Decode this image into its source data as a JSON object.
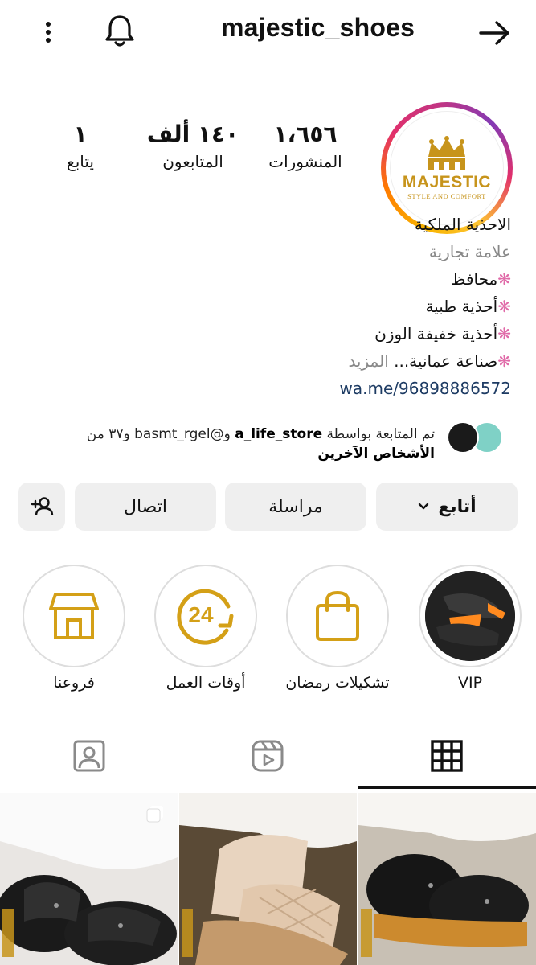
{
  "header": {
    "username": "majestic_shoes",
    "icons": [
      "more-vertical-icon",
      "bell-icon",
      "back-arrow-icon"
    ]
  },
  "avatar": {
    "brand": "MAJESTIC",
    "tagline": "STYLE AND COMFORT"
  },
  "stats": {
    "posts": {
      "value": "١،٦٥٦",
      "label": "المنشورات"
    },
    "followers": {
      "value": "١٤٠ ألف",
      "label": "المتابعون"
    },
    "following": {
      "value": "١",
      "label": "يتابع"
    }
  },
  "bio": {
    "name": "الاحذية الملكية",
    "category": "علامة تجارية",
    "lines": [
      "محافظ",
      "أحذية طبية",
      "أحذية خفيفة الوزن",
      "صناعة عمانية..."
    ],
    "more": " المزيد",
    "link": "wa.me/96898886572"
  },
  "followed_by": {
    "prefix": "تم المتابعة بواسطة ",
    "user1": "a_life_store",
    "mid": " و@basmt_rgel و٣٧ من",
    "suffix": "الأشخاص الآخرين"
  },
  "actions": {
    "follow": "أتابع",
    "message": "مراسلة",
    "contact": "اتصال"
  },
  "highlights": [
    {
      "label": "VIP"
    },
    {
      "label": "تشكيلات رمضان"
    },
    {
      "label": "أوقات العمل",
      "badge": "24"
    },
    {
      "label": "فروعنا"
    }
  ],
  "colors": {
    "accent_gold": "#d4a017",
    "button_bg": "#efefef",
    "link": "#1d3b63"
  }
}
